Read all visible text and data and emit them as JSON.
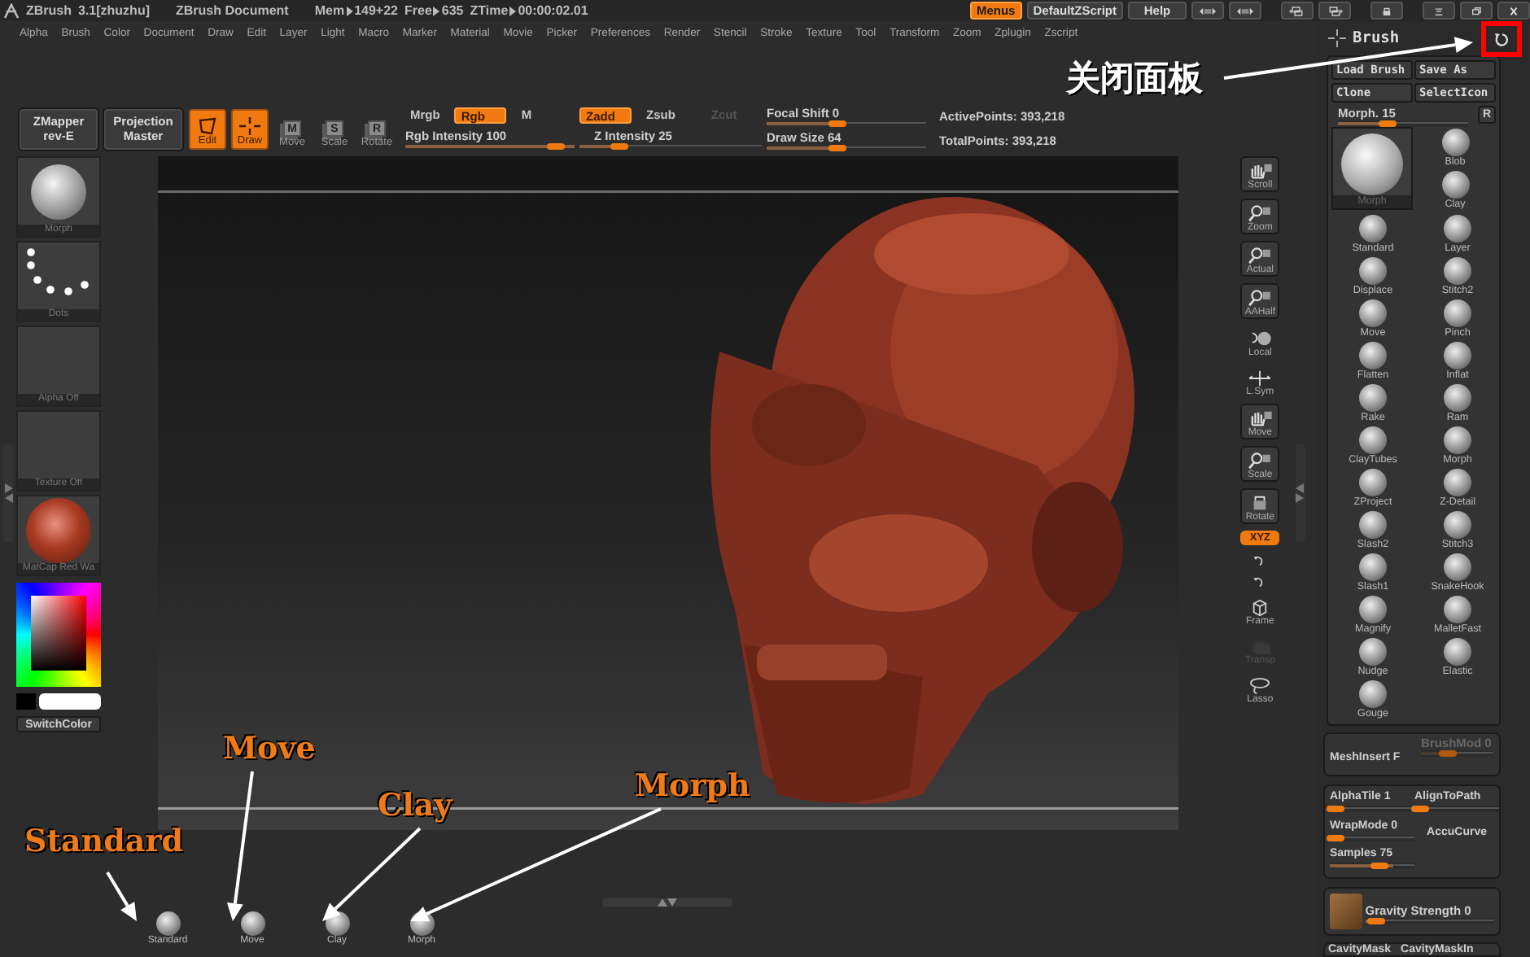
{
  "title_bar": {
    "app": "ZBrush",
    "version": "3.1[zhuzhu]",
    "document": "ZBrush Document",
    "stats": [
      {
        "label": "Mem",
        "value": "149+22"
      },
      {
        "label": "Free",
        "value": "635"
      },
      {
        "label": "ZTime",
        "value": "00:00:02.01"
      }
    ],
    "buttons": [
      {
        "label": "Menus",
        "selected": true
      },
      {
        "label": "DefaultZScript",
        "selected": false
      },
      {
        "label": "Help",
        "selected": false
      }
    ]
  },
  "menu": [
    "Alpha",
    "Brush",
    "Color",
    "Document",
    "Draw",
    "Edit",
    "Layer",
    "Light",
    "Macro",
    "Marker",
    "Material",
    "Movie",
    "Picker",
    "Preferences",
    "Render",
    "Stencil",
    "Stroke",
    "Texture",
    "Tool",
    "Transform",
    "Zoom",
    "Zplugin",
    "Zscript"
  ],
  "toolbar": {
    "plugins": [
      {
        "line1": "ZMapper",
        "line2": "rev-E"
      },
      {
        "line1": "Projection",
        "line2": "Master"
      }
    ],
    "modes": [
      {
        "label": "Edit",
        "selected": true
      },
      {
        "label": "Draw",
        "selected": true
      },
      {
        "label": "Move",
        "glyph": "M",
        "selected": false
      },
      {
        "label": "Scale",
        "glyph": "S",
        "selected": false
      },
      {
        "label": "Rotate",
        "glyph": "R",
        "selected": false
      }
    ],
    "color_modes": [
      {
        "label": "Mrgb",
        "selected": false
      },
      {
        "label": "Rgb",
        "selected": true
      },
      {
        "label": "M",
        "selected": false
      }
    ],
    "z_modes": [
      {
        "label": "Zadd",
        "selected": true,
        "disabled": false
      },
      {
        "label": "Zsub",
        "selected": false,
        "disabled": false
      },
      {
        "label": "Zcut",
        "selected": false,
        "disabled": true
      }
    ],
    "sliders": [
      {
        "label": "Rgb Intensity 100",
        "level": 1.0
      },
      {
        "label": "Z Intensity 25",
        "level": 0.25
      },
      {
        "label": "Focal Shift 0",
        "level": 0.5
      },
      {
        "label": "Draw Size 64",
        "level": 0.5
      }
    ],
    "points": [
      "ActivePoints: 393,218",
      "TotalPoints: 393,218"
    ]
  },
  "left_shelf": {
    "thumbs": [
      {
        "label": "Morph",
        "kind": "sphere"
      },
      {
        "label": "Dots",
        "kind": "dots"
      },
      {
        "label": "Alpha  Off",
        "kind": "empty"
      },
      {
        "label": "Texture  Off",
        "kind": "empty"
      },
      {
        "label": "MatCap  Red  Wa",
        "kind": "matcap"
      }
    ],
    "switch_color": "SwitchColor"
  },
  "view_tools": [
    {
      "label": "Scroll",
      "kind": "framed",
      "selected": false,
      "disabled": false
    },
    {
      "label": "Zoom",
      "kind": "framed",
      "selected": false,
      "disabled": false
    },
    {
      "label": "Actual",
      "kind": "framed",
      "selected": false,
      "disabled": false
    },
    {
      "label": "AAHalf",
      "kind": "framed",
      "selected": false,
      "disabled": false
    },
    {
      "label": "Local",
      "kind": "plain",
      "selected": false,
      "disabled": false
    },
    {
      "label": "L.Sym",
      "kind": "plain",
      "selected": false,
      "disabled": false
    },
    {
      "label": "Move",
      "kind": "framed",
      "selected": false,
      "disabled": false
    },
    {
      "label": "Scale",
      "kind": "framed",
      "selected": false,
      "disabled": false
    },
    {
      "label": "Rotate",
      "kind": "framed",
      "selected": false,
      "disabled": false
    },
    {
      "label": "XYZ",
      "kind": "toggle",
      "selected": true,
      "disabled": false
    },
    {
      "kind": "mini",
      "selected": false,
      "disabled": false
    },
    {
      "kind": "mini",
      "selected": false,
      "disabled": false
    },
    {
      "label": "Frame",
      "kind": "plain",
      "selected": false,
      "disabled": false
    },
    {
      "label": "Transp",
      "kind": "plain",
      "selected": false,
      "disabled": true
    },
    {
      "label": "Lasso",
      "kind": "plain",
      "selected": false,
      "disabled": false
    }
  ],
  "bottom_shelf": [
    {
      "label": "Standard"
    },
    {
      "label": "Move"
    },
    {
      "label": "Clay"
    },
    {
      "label": "Morph"
    }
  ],
  "brush_panel": {
    "title": "Brush",
    "buttons": [
      "Load Brush",
      "Save As",
      "Clone",
      "SelectIcon"
    ],
    "slider": {
      "label": "Morph. 15",
      "level": 0.45
    },
    "reset": "R",
    "current": {
      "label": "Morph"
    },
    "brushes": [
      {
        "label": "Blob",
        "selected": false
      },
      {
        "label": "Clay",
        "selected": false
      },
      {
        "label": "Standard",
        "selected": false
      },
      {
        "label": "Layer",
        "selected": false
      },
      {
        "label": "Displace",
        "selected": false
      },
      {
        "label": "Stitch2",
        "selected": false
      },
      {
        "label": "Move",
        "selected": false
      },
      {
        "label": "Pinch",
        "selected": false
      },
      {
        "label": "Flatten",
        "selected": false
      },
      {
        "label": "Inflat",
        "selected": false
      },
      {
        "label": "Rake",
        "selected": false
      },
      {
        "label": "Ram",
        "selected": false
      },
      {
        "label": "ClayTubes",
        "selected": false
      },
      {
        "label": "Morph",
        "selected": false
      },
      {
        "label": "ZProject",
        "selected": false
      },
      {
        "label": "Z-Detail",
        "selected": false
      },
      {
        "label": "Slash2",
        "selected": false
      },
      {
        "label": "Stitch3",
        "selected": false
      },
      {
        "label": "Slash1",
        "selected": false
      },
      {
        "label": "SnakeHook",
        "selected": false
      },
      {
        "label": "Magnify",
        "selected": false
      },
      {
        "label": "MalletFast",
        "selected": false
      },
      {
        "label": "Nudge",
        "selected": false
      },
      {
        "label": "Elastic",
        "selected": false
      },
      {
        "label": "Gouge",
        "selected": false
      }
    ]
  },
  "mesh_insert": {
    "label": "MeshInsert F",
    "slider": {
      "label": "BrushMod 0",
      "level": 0.5,
      "disabled": true
    }
  },
  "stroke_options": [
    {
      "kind": "slider",
      "label": "AlphaTile 1",
      "level": 0.1
    },
    {
      "kind": "slider",
      "label": "AlignToPath",
      "level": 0.1
    },
    {
      "kind": "slider",
      "label": "WrapMode 0",
      "level": 0.1
    },
    {
      "kind": "toggle",
      "label": "AccuCurve"
    },
    {
      "kind": "slider",
      "label": "Samples 75",
      "level": 0.75
    }
  ],
  "gravity": {
    "label": "Gravity Strength 0",
    "level": 0.1
  },
  "cavity": [
    "CavityMask",
    "CavityMaskIn"
  ],
  "annotations": [
    {
      "kind": "cjk",
      "text": "关闭面板"
    },
    {
      "kind": "tag",
      "text": "Standard"
    },
    {
      "kind": "tag",
      "text": "Move"
    },
    {
      "kind": "tag",
      "text": "Clay"
    },
    {
      "kind": "tag",
      "text": "Morph"
    }
  ]
}
